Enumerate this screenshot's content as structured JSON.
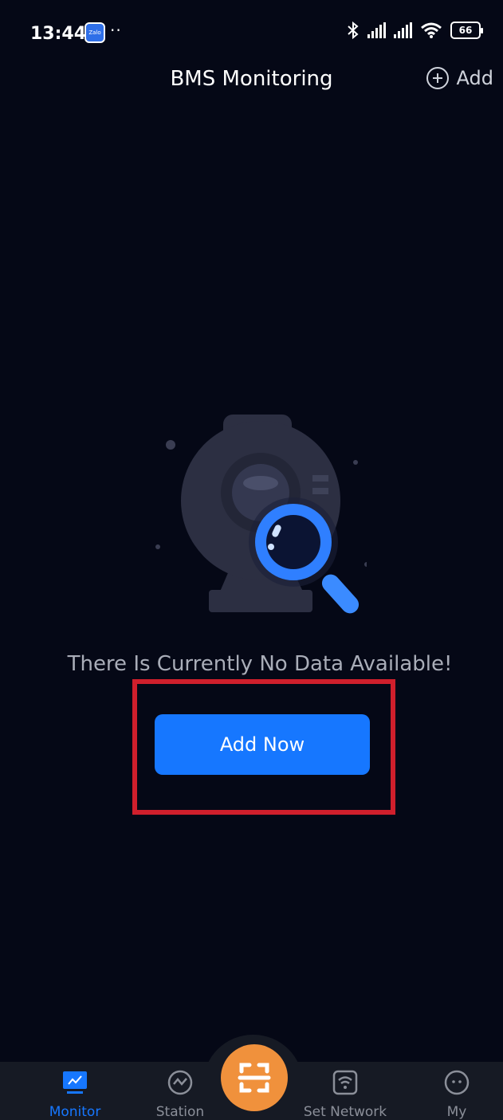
{
  "status_bar": {
    "time": "13:44",
    "app_badge": "Zalo",
    "dots": "··",
    "battery": "66"
  },
  "header": {
    "title": "BMS Monitoring",
    "add_label": "Add"
  },
  "empty_state": {
    "message": "There Is Currently No Data Available!",
    "button_label": "Add Now"
  },
  "bottom_nav": {
    "items": [
      {
        "label": "Monitor",
        "icon": "monitor-chart-icon",
        "active": true
      },
      {
        "label": "Station",
        "icon": "station-gauge-icon",
        "active": false
      },
      {
        "label": "Set Network",
        "icon": "wifi-icon",
        "active": false
      },
      {
        "label": "My",
        "icon": "profile-face-icon",
        "active": false
      }
    ],
    "scan_icon": "scan-icon"
  },
  "colors": {
    "background": "#050816",
    "accent": "#1677ff",
    "scan_button": "#f0913c",
    "highlight": "#d01f2c"
  }
}
